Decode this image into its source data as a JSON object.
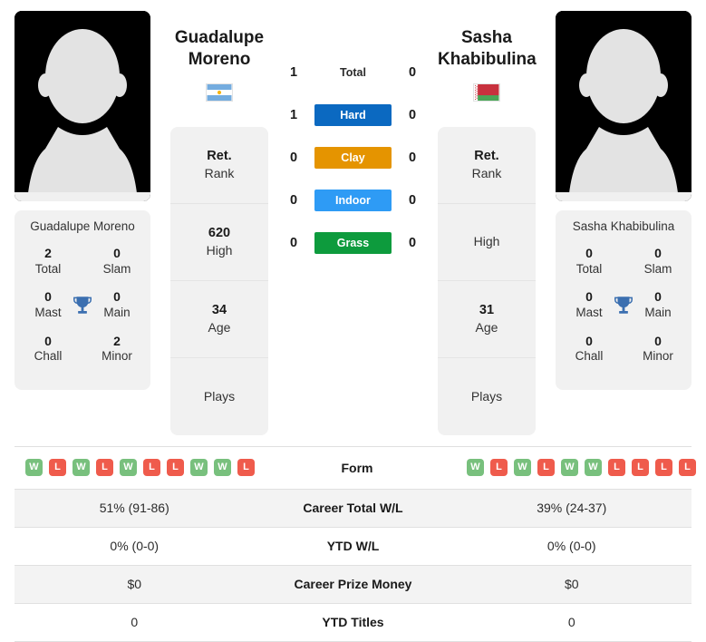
{
  "players": {
    "left": {
      "first_name": "Guadalupe",
      "last_name": "Moreno",
      "full_name": "Guadalupe Moreno",
      "country": "Argentina",
      "flag_icon": "flag-argentina-icon",
      "avatar_icon": "player-avatar-placeholder-icon",
      "titles": {
        "total_value": "2",
        "total_label": "Total",
        "slam_value": "0",
        "slam_label": "Slam",
        "mast_value": "0",
        "mast_label": "Mast",
        "main_value": "0",
        "main_label": "Main",
        "chall_value": "0",
        "chall_label": "Chall",
        "minor_value": "2",
        "minor_label": "Minor",
        "trophy_icon": "trophy-icon"
      },
      "info": {
        "rank_value": "Ret.",
        "rank_label": "Rank",
        "high_value": "620",
        "high_label": "High",
        "age_value": "34",
        "age_label": "Age",
        "plays_value": "",
        "plays_label": "Plays"
      },
      "form": [
        "W",
        "L",
        "W",
        "L",
        "W",
        "L",
        "L",
        "W",
        "W",
        "L"
      ],
      "career_total_wl": "51% (91-86)",
      "ytd_wl": "0% (0-0)",
      "career_prize_money": "$0",
      "ytd_titles": "0"
    },
    "right": {
      "first_name": "Sasha",
      "last_name": "Khabibulina",
      "full_name": "Sasha Khabibulina",
      "country": "Belarus",
      "flag_icon": "flag-belarus-icon",
      "avatar_icon": "player-avatar-placeholder-icon",
      "titles": {
        "total_value": "0",
        "total_label": "Total",
        "slam_value": "0",
        "slam_label": "Slam",
        "mast_value": "0",
        "mast_label": "Mast",
        "main_value": "0",
        "main_label": "Main",
        "chall_value": "0",
        "chall_label": "Chall",
        "minor_value": "0",
        "minor_label": "Minor",
        "trophy_icon": "trophy-icon"
      },
      "info": {
        "rank_value": "Ret.",
        "rank_label": "Rank",
        "high_value": "",
        "high_label": "High",
        "age_value": "31",
        "age_label": "Age",
        "plays_value": "",
        "plays_label": "Plays"
      },
      "form": [
        "W",
        "L",
        "W",
        "L",
        "W",
        "W",
        "L",
        "L",
        "L",
        "L"
      ],
      "career_total_wl": "39% (24-37)",
      "ytd_wl": "0% (0-0)",
      "career_prize_money": "$0",
      "ytd_titles": "0"
    }
  },
  "head_to_head": [
    {
      "label": "Total",
      "left": "1",
      "right": "0",
      "surface": false,
      "color": ""
    },
    {
      "label": "Hard",
      "left": "1",
      "right": "0",
      "surface": true,
      "color": "#0b69c1"
    },
    {
      "label": "Clay",
      "left": "0",
      "right": "0",
      "surface": true,
      "color": "#e59400"
    },
    {
      "label": "Indoor",
      "left": "0",
      "right": "0",
      "surface": true,
      "color": "#2e9bf5"
    },
    {
      "label": "Grass",
      "left": "0",
      "right": "0",
      "surface": true,
      "color": "#0d9b3d"
    }
  ],
  "stats_rows": [
    {
      "label": "Form",
      "left": "",
      "right": "",
      "type": "form"
    },
    {
      "label": "Career Total W/L",
      "left": "51% (91-86)",
      "right": "39% (24-37)",
      "type": "text"
    },
    {
      "label": "YTD W/L",
      "left": "0% (0-0)",
      "right": "0% (0-0)",
      "type": "text"
    },
    {
      "label": "Career Prize Money",
      "left": "$0",
      "right": "$0",
      "type": "text"
    },
    {
      "label": "YTD Titles",
      "left": "0",
      "right": "0",
      "type": "text"
    }
  ],
  "colors": {
    "badge_win": "#78c07d",
    "badge_loss": "#ef5b4c",
    "card_bg": "#f1f1f1",
    "row_alt_bg": "#f3f3f3",
    "trophy": "#3b6fb0"
  }
}
